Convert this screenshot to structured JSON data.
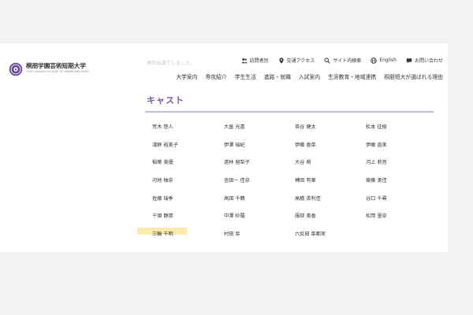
{
  "header": {
    "logo_name": "桐朋学園芸術短期大学",
    "logo_sub": "TOHO GAKUEN COLLEGE OF DRAMA AND MUSIC",
    "faded_text": "承的出演てしました。"
  },
  "utility": [
    {
      "label": "訪問者別",
      "icon": "visitors-icon"
    },
    {
      "label": "交通アクセス",
      "icon": "location-pin-icon"
    },
    {
      "label": "サイト内検索",
      "icon": "search-icon"
    },
    {
      "label": "English",
      "icon": "globe-icon"
    },
    {
      "label": "お問い合わせ",
      "icon": "mail-icon"
    }
  ],
  "nav": [
    "大学案内",
    "専攻紹介",
    "学生生活",
    "進路・就職",
    "入試案内",
    "生涯教育・地域連携",
    "桐朋短大が選ばれる理由"
  ],
  "section": {
    "title": "キャスト"
  },
  "cast": [
    [
      "荒木 悠人",
      "大畠 光喜",
      "茶谷 健太",
      "松本 征樹"
    ],
    [
      "淺野 裕美子",
      "伊澤 瑞妃",
      "伊藤 香菜",
      "伊藤 直美"
    ],
    [
      "稲葉 美優",
      "遠林 留梨子",
      "大谷 萌",
      "河上 莉音"
    ],
    [
      "河地 柚奈",
      "金田一 佳奈",
      "榑田 有華",
      "齋藤 美佳"
    ],
    [
      "佐藤 瑞季",
      "高田 千鶴",
      "高橋 英利佳",
      "谷口 千尋"
    ],
    [
      "千頭 静那",
      "中澤 紗羅",
      "服部 美香",
      "松岡 里奈"
    ],
    [
      "三輪 千明",
      "村田 栞",
      "六反田 菜都実",
      ""
    ]
  ],
  "colors": {
    "accent": "#7b57a8",
    "highlight": "#f7e394",
    "background": "#f2f2f2"
  }
}
